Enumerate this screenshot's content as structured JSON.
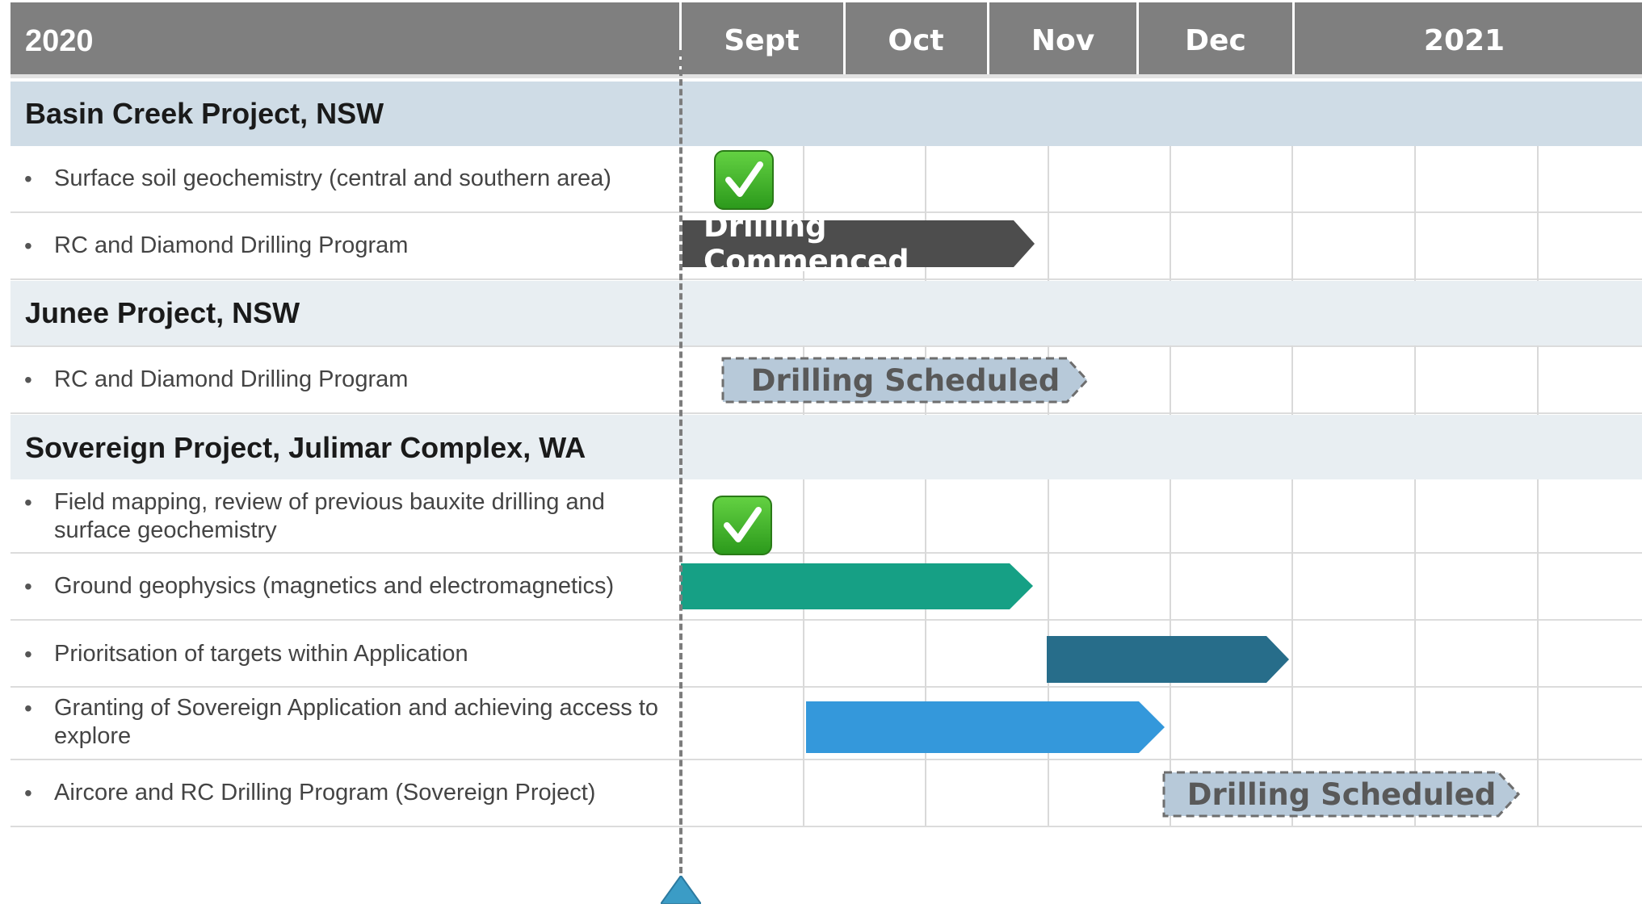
{
  "header": {
    "year_left": "2020",
    "months": [
      "Sept",
      "Oct",
      "Nov",
      "Dec"
    ],
    "year_right": "2021"
  },
  "sections": [
    {
      "title": "Basin Creek Project, NSW",
      "tasks": [
        "Surface soil geochemistry (central and southern area)",
        "RC and Diamond Drilling Program"
      ]
    },
    {
      "title": "Junee Project, NSW",
      "tasks": [
        "RC and Diamond Drilling Program"
      ]
    },
    {
      "title": "Sovereign Project, Julimar Complex, WA",
      "tasks": [
        "Field mapping, review of previous bauxite drilling and surface geochemistry",
        "Ground geophysics (magnetics and electromagnetics)",
        "Prioritsation of targets within Application",
        "Granting of Sovereign Application and achieving access to explore",
        "Aircore and RC Drilling Program (Sovereign Project)"
      ]
    }
  ],
  "bullet_glyph": "•",
  "bar_labels": {
    "drilling_commenced": "Drilling Commenced",
    "drilling_scheduled_junee": "Drilling Scheduled",
    "drilling_scheduled_sovereign": "Drilling Scheduled"
  },
  "colors": {
    "header": "#7f7f7f",
    "band_primary": "#cfdce6",
    "band_secondary": "#e8eef2",
    "commenced": "#4d4d4d",
    "scheduled_fill": "#b7c9d9",
    "scheduled_text": "#595959",
    "geophysics": "#16a085",
    "prioritisation": "#276d8a",
    "granting": "#3498db",
    "today_marker": "#3b9cc6",
    "check": "#3fb42a"
  },
  "icons": {
    "completed": "check-mark-icon",
    "today": "triangle-up-icon"
  }
}
